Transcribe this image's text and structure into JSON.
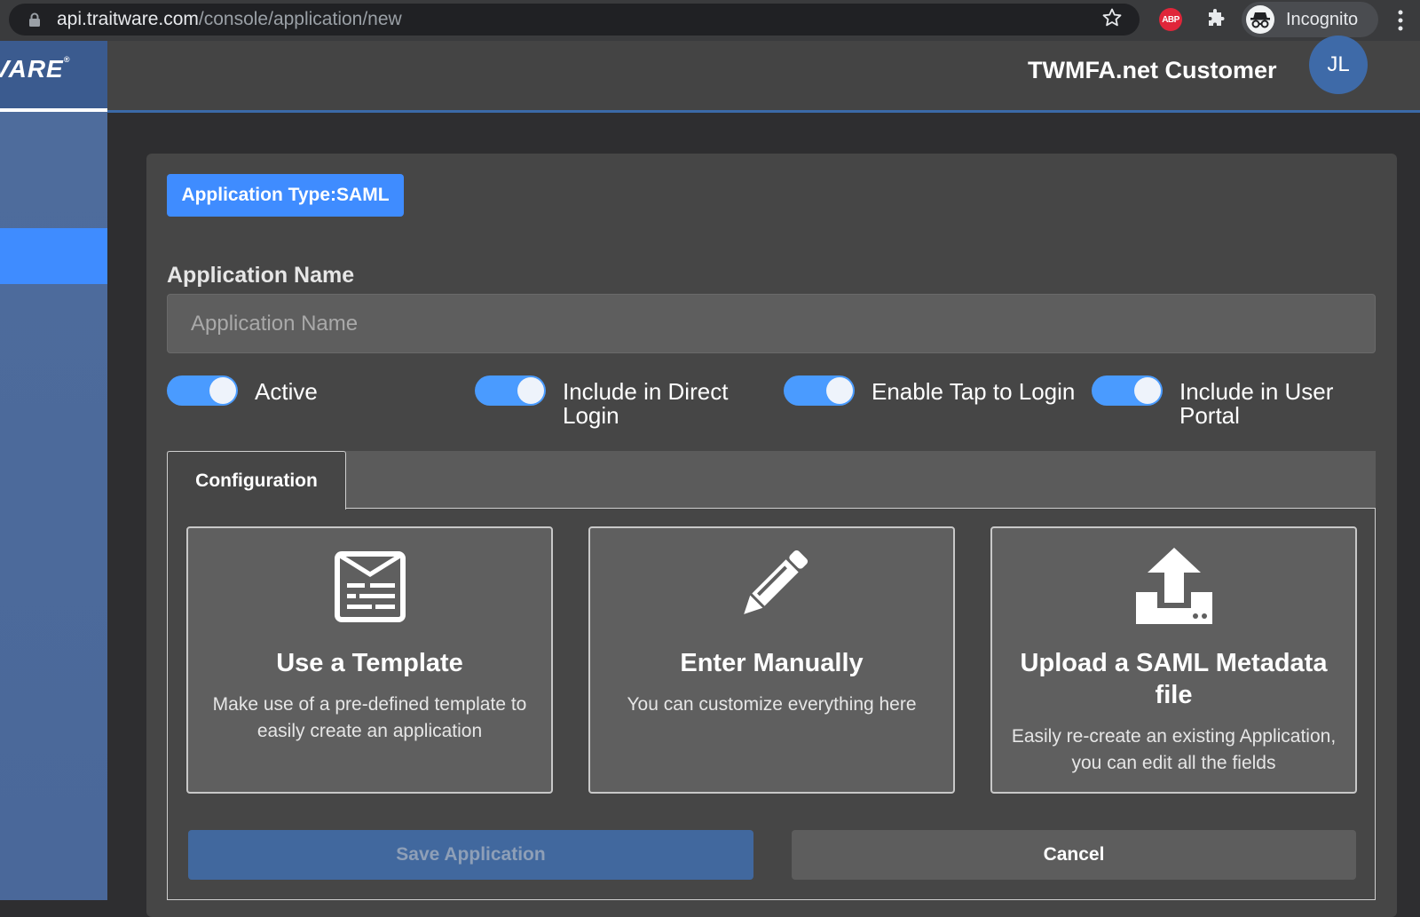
{
  "browser": {
    "url_host": "api.traitware.com",
    "url_path": "/console/application/new",
    "abp_label": "ABP",
    "incognito_label": "Incognito"
  },
  "header": {
    "logo_text": "VARE",
    "logo_mark": "®",
    "org_name": "TWMFA.net Customer",
    "avatar_initials": "JL"
  },
  "form": {
    "type_badge": "Application Type:SAML",
    "name_label": "Application Name",
    "name_value": "",
    "name_placeholder": "Application Name",
    "toggles": [
      {
        "label": "Active",
        "on": true
      },
      {
        "label": "Include in Direct Login",
        "on": true
      },
      {
        "label": "Enable Tap to Login",
        "on": true
      },
      {
        "label": "Include in User Portal",
        "on": true
      }
    ]
  },
  "tabs": [
    {
      "label": "Configuration",
      "active": true
    }
  ],
  "options": [
    {
      "icon": "template-icon",
      "title": "Use a Template",
      "description": "Make use of a pre-defined template to easily create an application"
    },
    {
      "icon": "pencil-icon",
      "title": "Enter Manually",
      "description": "You can customize everything here"
    },
    {
      "icon": "upload-icon",
      "title": "Upload a SAML Metadata file",
      "description": "Easily re-create an existing Application, you can edit all the fields"
    }
  ],
  "actions": {
    "save_label": "Save Application",
    "cancel_label": "Cancel"
  },
  "colors": {
    "accent": "#3f8cff",
    "toggle_on": "#4a9bff",
    "sidebar": "#4e6c9c",
    "card_bg": "#464646"
  }
}
